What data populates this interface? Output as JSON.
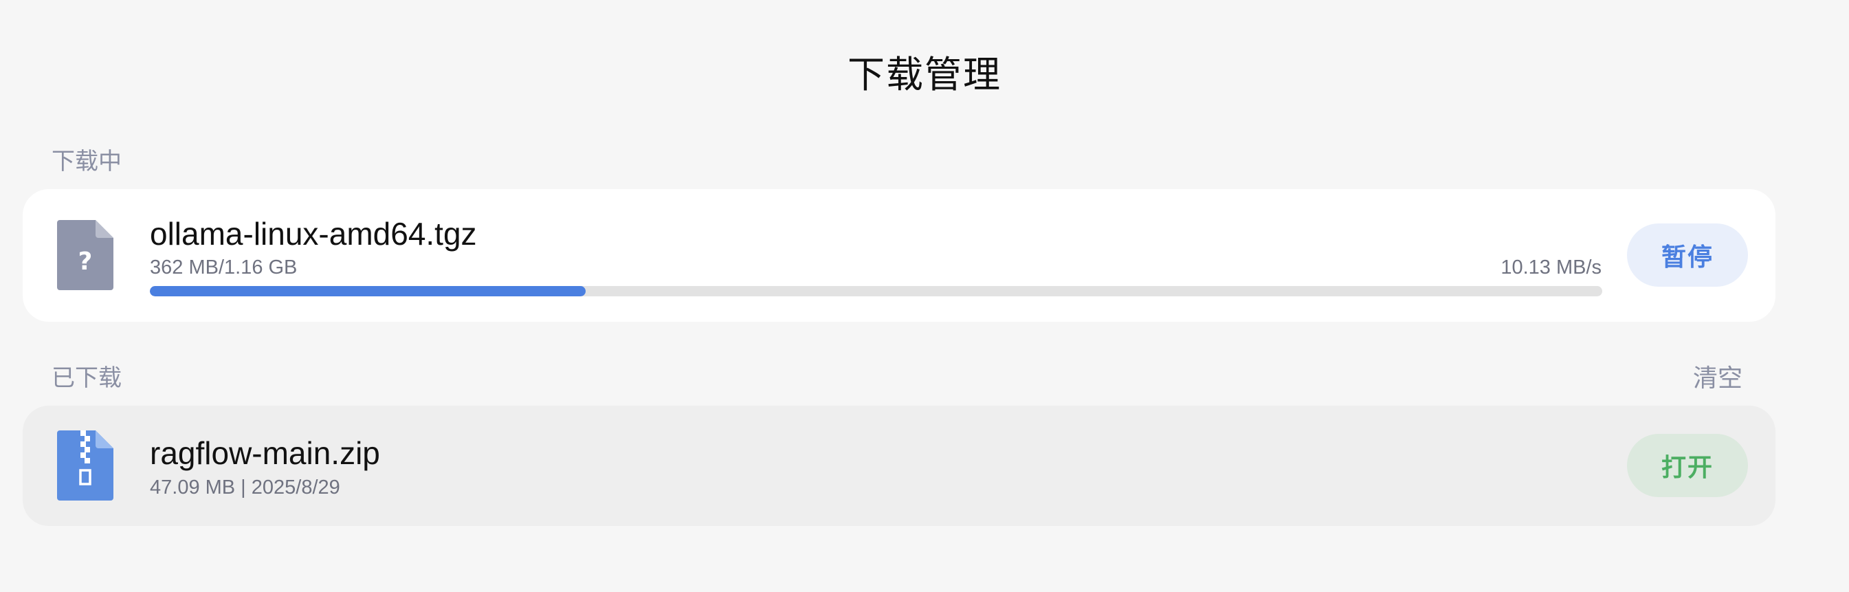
{
  "page": {
    "title": "下载管理"
  },
  "downloading": {
    "section_label": "下载中",
    "items": [
      {
        "file_name": "ollama-linux-amd64.tgz",
        "size_progress": "362 MB/1.16 GB",
        "speed": "10.13 MB/s",
        "progress_fraction": 0.3,
        "icon": "unknown-file-icon",
        "action_label": "暂停"
      }
    ]
  },
  "downloaded": {
    "section_label": "已下载",
    "clear_label": "清空",
    "items": [
      {
        "file_name": "ragflow-main.zip",
        "meta": "47.09 MB | 2025/8/29",
        "icon": "zip-file-icon",
        "action_label": "打开"
      }
    ]
  },
  "colors": {
    "accent_blue": "#4a7fe0",
    "open_green": "#4cae62",
    "unknown_icon": "#8f95ab",
    "zip_icon": "#5b8de0"
  }
}
